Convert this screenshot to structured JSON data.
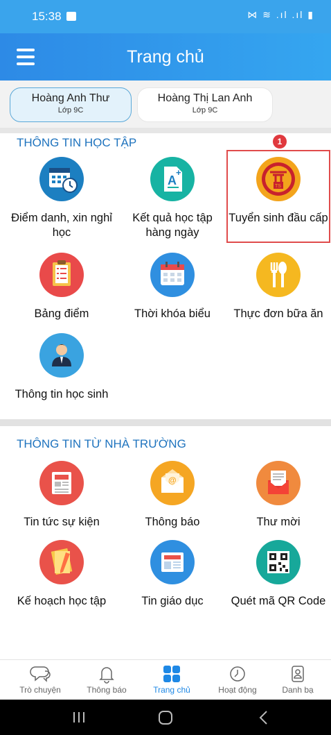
{
  "status_bar": {
    "time": "15:38",
    "icons_text": "⋈ ≋ .ıl .ıl ▮"
  },
  "app_bar": {
    "title": "Trang chủ",
    "menu_icon": "hamburger-menu-icon"
  },
  "students": [
    {
      "name": "Hoàng Anh Thư",
      "class": "Lớp 9C",
      "active": true
    },
    {
      "name": "Hoàng Thị Lan Anh",
      "class": "Lớp 9C",
      "active": false
    }
  ],
  "sections": [
    {
      "title": "THÔNG TIN HỌC TẬP",
      "items": [
        {
          "label": "Điểm danh, xin nghỉ học",
          "icon": "calendar-clock-icon"
        },
        {
          "label": "Kết quả học tập hàng ngày",
          "icon": "grade-document-icon"
        },
        {
          "label": "Tuyển sinh đầu cấp",
          "icon": "hanoi-emblem-icon",
          "badge": "1",
          "highlighted": true
        },
        {
          "label": "Bảng điểm",
          "icon": "checklist-icon"
        },
        {
          "label": "Thời khóa biểu",
          "icon": "calendar-icon"
        },
        {
          "label": "Thực đơn bữa ăn",
          "icon": "fork-spoon-icon"
        },
        {
          "label": "Thông tin học sinh",
          "icon": "student-icon"
        }
      ]
    },
    {
      "title": "THÔNG TIN TỪ NHÀ TRƯỜNG",
      "items": [
        {
          "label": "Tin tức sự kiện",
          "icon": "newspaper-icon"
        },
        {
          "label": "Thông báo",
          "icon": "envelope-at-icon"
        },
        {
          "label": "Thư mời",
          "icon": "invitation-letter-icon"
        },
        {
          "label": "Kế hoạch học tập",
          "icon": "notebook-pencil-icon"
        },
        {
          "label": "Tin giáo dục",
          "icon": "education-news-icon"
        },
        {
          "label": "Quét mã QR Code",
          "icon": "qr-code-icon"
        }
      ]
    }
  ],
  "bottom_nav": [
    {
      "label": "Trò chuyện",
      "icon": "chat-icon",
      "active": false
    },
    {
      "label": "Thông báo",
      "icon": "bell-icon",
      "active": false
    },
    {
      "label": "Trang chủ",
      "icon": "home-grid-icon",
      "active": true
    },
    {
      "label": "Hoạt động",
      "icon": "clock-icon",
      "active": false
    },
    {
      "label": "Danh bạ",
      "icon": "contacts-icon",
      "active": false
    }
  ],
  "colors": {
    "primary": "#2d8ae6",
    "section_title": "#1e73be",
    "highlight_border": "#e04b4b",
    "badge": "#e0393e",
    "nav_active": "#1e88e5"
  }
}
